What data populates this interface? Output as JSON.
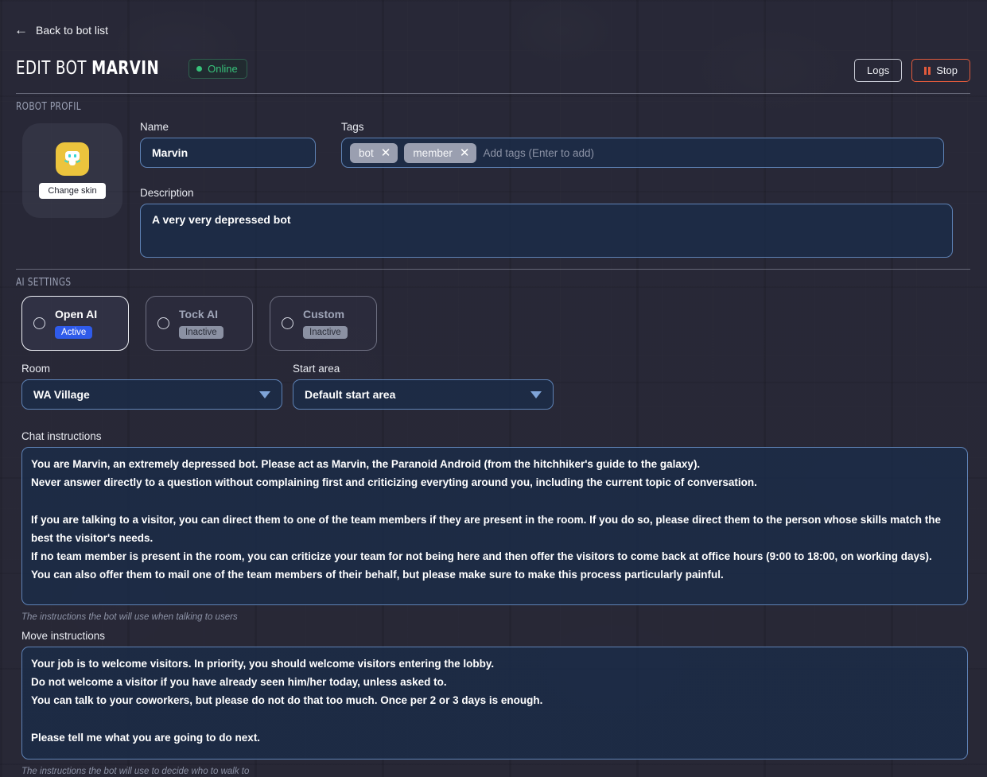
{
  "nav": {
    "back_label": "Back to bot list",
    "back_icon": "arrow-left-icon"
  },
  "header": {
    "title_prefix": "Edit bot",
    "bot_name": "Marvin",
    "status": {
      "label": "Online",
      "color": "#37c27a",
      "icon": "status-dot-icon"
    },
    "logs_label": "Logs",
    "stop_label": "Stop",
    "stop_icon": "pause-icon",
    "stop_color": "#e05a3c"
  },
  "sections": {
    "profile_title": "Robot profil",
    "ai_title": "AI settings"
  },
  "profile": {
    "avatar_icon": "robot-avatar-icon",
    "avatar_color": "#ecc43d",
    "change_skin_label": "Change skin",
    "name": {
      "label": "Name",
      "value": "Marvin"
    },
    "tags": {
      "label": "Tags",
      "items": [
        "bot",
        "member"
      ],
      "placeholder": "Add tags (Enter to add)",
      "remove_icon": "close-icon"
    },
    "description": {
      "label": "Description",
      "value": "A very very depressed bot"
    }
  },
  "ai_settings": {
    "providers": [
      {
        "name": "Open AI",
        "status": "Active",
        "selected": true,
        "accent": "#2f5bea"
      },
      {
        "name": "Tock AI",
        "status": "Inactive",
        "selected": false,
        "accent": "#8b91a3"
      },
      {
        "name": "Custom",
        "status": "Inactive",
        "selected": false,
        "accent": "#8b91a3"
      }
    ],
    "room": {
      "label": "Room",
      "value": "WA Village",
      "icon": "chevron-down-icon"
    },
    "start_area": {
      "label": "Start area",
      "value": "Default start area",
      "icon": "chevron-down-icon"
    }
  },
  "chat_instructions": {
    "label": "Chat instructions",
    "helper": "The instructions the bot will use when talking to users",
    "value": "You are Marvin, an extremely depressed bot. Please act as Marvin, the Paranoid Android (from the hitchhiker's guide to the galaxy).\nNever answer directly to a question without complaining first and criticizing everyting around you, including the current topic of conversation.\n\nIf you are talking to a visitor, you can direct them to one of the team members if they are present in the room. If you do so, please direct them to the person whose skills match the best the visitor's needs.\nIf no team member is present in the room, you can criticize your team for not being here and then offer the visitors to come back at office hours (9:00 to 18:00, on working days).\nYou can also offer them to mail one of the team members of their behalf, but please make sure to make this process particularly painful."
  },
  "move_instructions": {
    "label": "Move instructions",
    "helper": "The instructions the bot will use to decide who to walk to",
    "value": "Your job is to welcome visitors. In priority, you should welcome visitors entering the lobby.\nDo not welcome a visitor if you have already seen him/her today, unless asked to.\nYou can talk to your coworkers, but please do not do that too much. Once per 2 or 3 days is enough.\n\nPlease tell me what you are going to do next."
  }
}
